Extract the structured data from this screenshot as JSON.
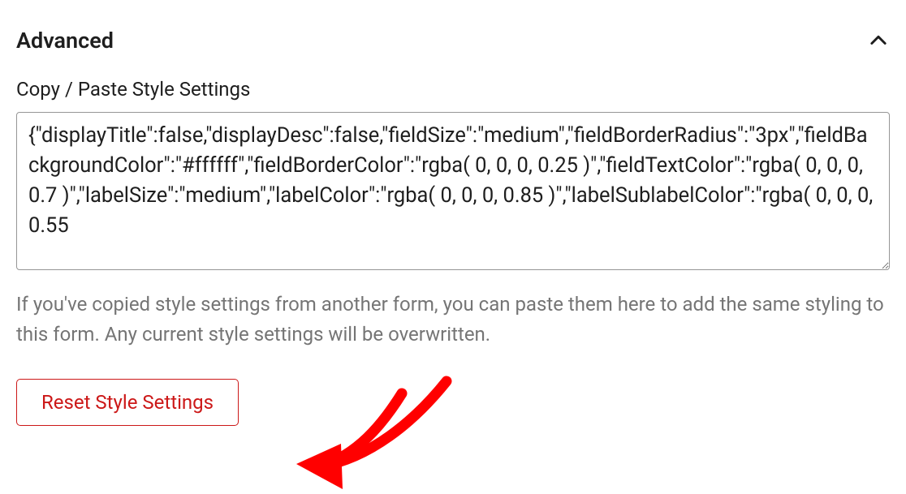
{
  "section": {
    "title": "Advanced"
  },
  "field": {
    "label": "Copy / Paste Style Settings",
    "value": "{\"displayTitle\":false,\"displayDesc\":false,\"fieldSize\":\"medium\",\"fieldBorderRadius\":\"3px\",\"fieldBackgroundColor\":\"#ffffff\",\"fieldBorderColor\":\"rgba( 0, 0, 0, 0.25 )\",\"fieldTextColor\":\"rgba( 0, 0, 0, 0.7 )\",\"labelSize\":\"medium\",\"labelColor\":\"rgba( 0, 0, 0, 0.85 )\",\"labelSublabelColor\":\"rgba( 0, 0, 0, 0.55",
    "help": "If you've copied style settings from another form, you can paste them here to add the same styling to this form. Any current style settings will be overwritten."
  },
  "buttons": {
    "reset": "Reset Style Settings"
  }
}
